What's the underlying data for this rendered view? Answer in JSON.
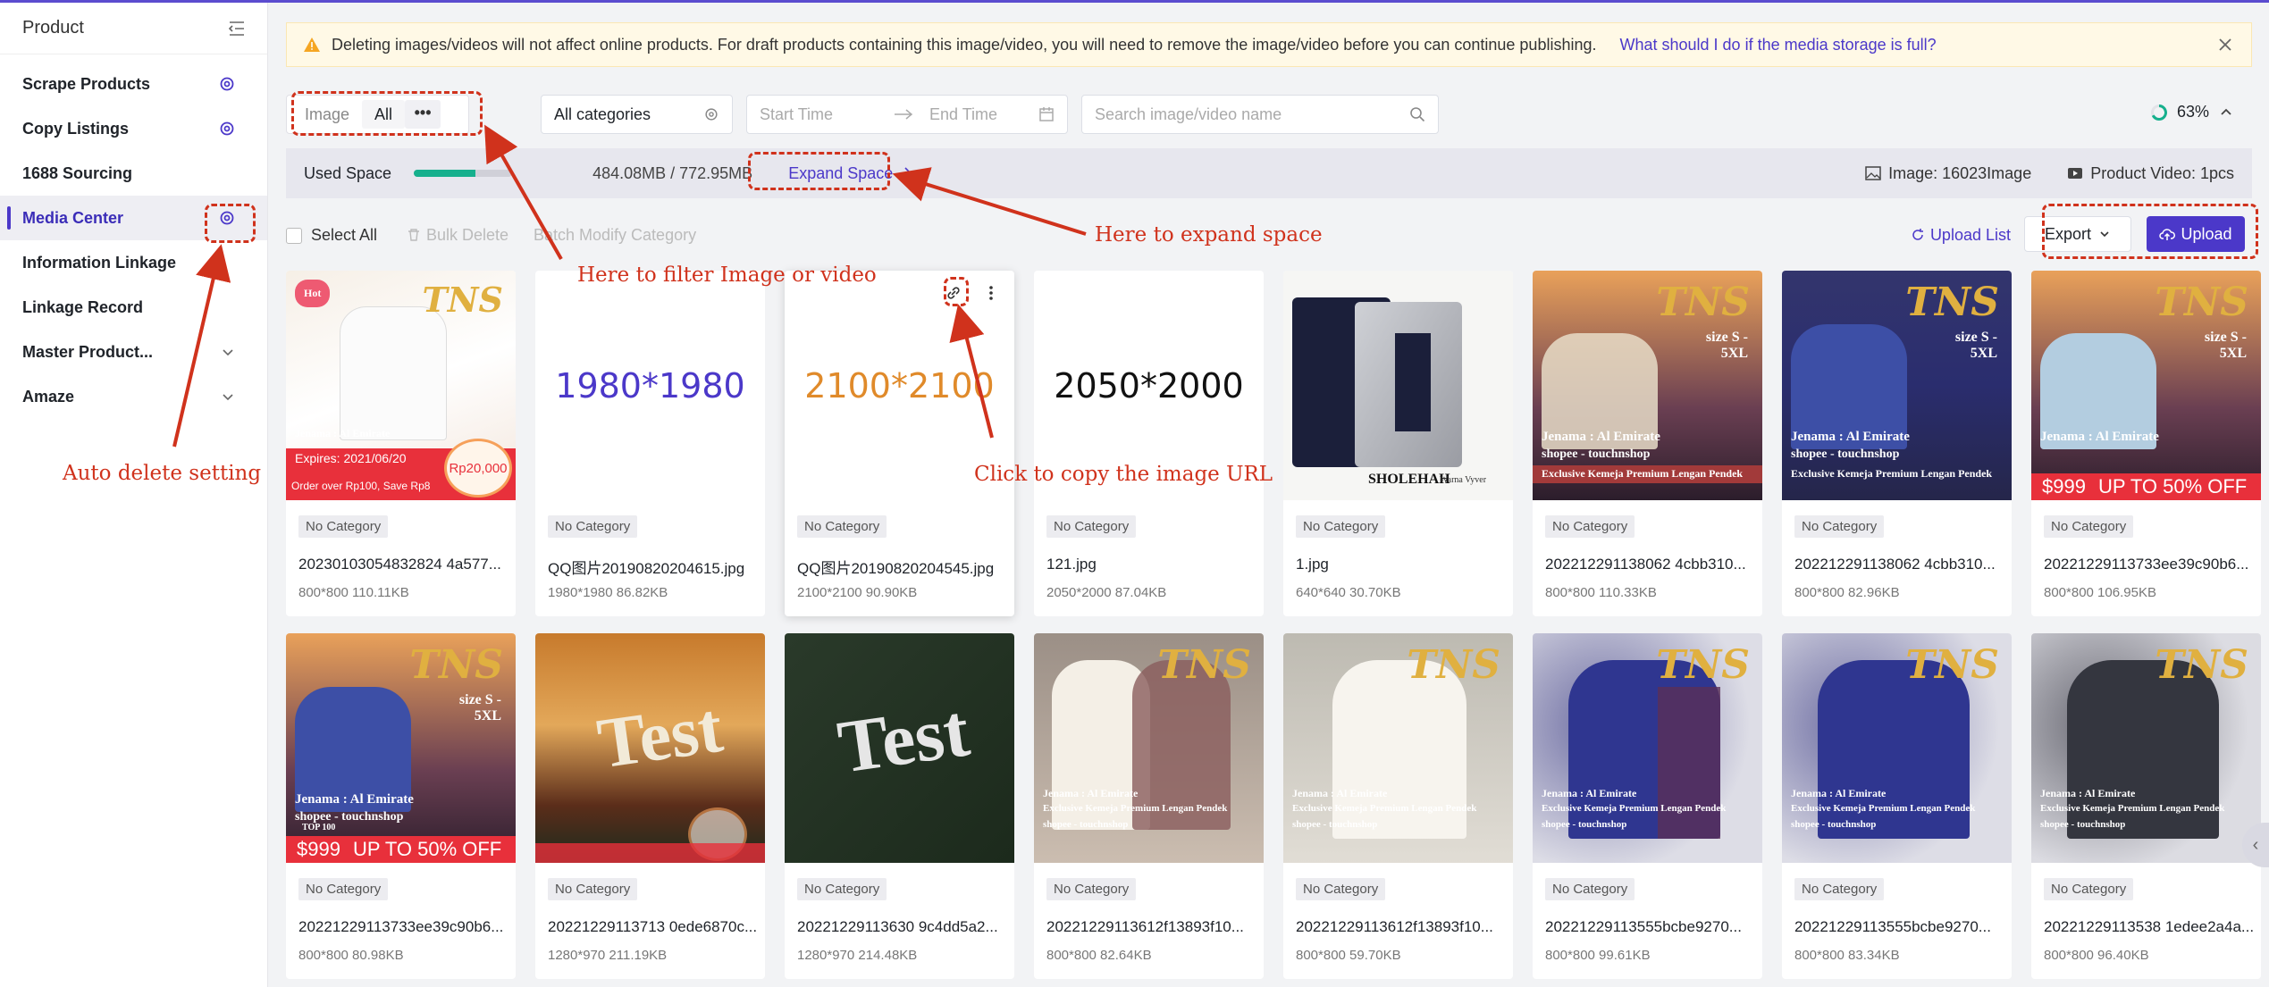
{
  "sidebar": {
    "title": "Product",
    "items": [
      {
        "label": "Scrape Products"
      },
      {
        "label": "Copy Listings"
      },
      {
        "label": "1688 Sourcing"
      },
      {
        "label": "Media Center"
      },
      {
        "label": "Information Linkage"
      },
      {
        "label": "Linkage Record"
      },
      {
        "label": "Master Product..."
      },
      {
        "label": "Amaze"
      }
    ]
  },
  "notice": {
    "text": "Deleting images/videos will not affect online products. For draft products containing this image/video, you will need to remove the image/video before you can continue publishing.",
    "help_link": "What should I do if the media storage is full?"
  },
  "filters": {
    "type_image": "Image",
    "type_all": "All",
    "more": "•••",
    "category": "All categories",
    "start_placeholder": "Start Time",
    "end_placeholder": "End Time",
    "search_placeholder": "Search image/video name",
    "progress": "63%"
  },
  "space": {
    "label": "Used Space",
    "usage": "484.08MB / 772.95MB",
    "used_fraction": 0.63,
    "expand": "Expand Space",
    "image_count": "Image: 16023Image",
    "video_count": "Product Video: 1pcs"
  },
  "actions": {
    "select_all": "Select All",
    "bulk_delete": "Bulk Delete",
    "batch_modify": "Batch Modify Category",
    "upload_list": "Upload List",
    "export": "Export",
    "upload": "Upload"
  },
  "cards": [
    {
      "category": "No Category",
      "name": "20230103054832824 4a577...",
      "meta": "800*800  110.11KB"
    },
    {
      "category": "No Category",
      "name": "QQ图片20190820204615.jpg",
      "meta": "1980*1980  86.82KB",
      "placeholder": "1980*1980"
    },
    {
      "category": "No Category",
      "name": "QQ图片20190820204545.jpg",
      "meta": "2100*2100  90.90KB",
      "placeholder": "2100*2100"
    },
    {
      "category": "No Category",
      "name": "121.jpg",
      "meta": "2050*2000  87.04KB",
      "placeholder": "2050*2000"
    },
    {
      "category": "No Category",
      "name": "1.jpg",
      "meta": "640*640  30.70KB"
    },
    {
      "category": "No Category",
      "name": "202212291138062 4cbb310...",
      "meta": "800*800  110.33KB"
    },
    {
      "category": "No Category",
      "name": "202212291138062 4cbb310...",
      "meta": "800*800  82.96KB"
    },
    {
      "category": "No Category",
      "name": "20221229113733ee39c90b6...",
      "meta": "800*800  106.95KB"
    },
    {
      "category": "No Category",
      "name": "20221229113733ee39c90b6...",
      "meta": "800*800  80.98KB"
    },
    {
      "category": "No Category",
      "name": "20221229113713 0ede6870c...",
      "meta": "1280*970  211.19KB"
    },
    {
      "category": "No Category",
      "name": "20221229113630 9c4dd5a2...",
      "meta": "1280*970  214.48KB"
    },
    {
      "category": "No Category",
      "name": "20221229113612f13893f10...",
      "meta": "800*800  82.64KB"
    },
    {
      "category": "No Category",
      "name": "20221229113612f13893f10...",
      "meta": "800*800  59.70KB"
    },
    {
      "category": "No Category",
      "name": "20221229113555bcbe9270...",
      "meta": "800*800  99.61KB"
    },
    {
      "category": "No Category",
      "name": "20221229113555bcbe9270...",
      "meta": "800*800  83.34KB"
    },
    {
      "category": "No Category",
      "name": "20221229113538 1edee2a4a...",
      "meta": "800*800  96.40KB"
    }
  ],
  "thumb_text": {
    "brand": "TNS",
    "size": "size S - 5XL",
    "jenama": "Jenama : Al Emirate",
    "shopee": "shopee - touchnshop",
    "exclusive": "Exclusive Kemeja Premium Lengan Pendek",
    "expires": "Expires:  2021/06/20",
    "hot": "Hot",
    "order_over": "Order over Rp100, Save Rp8",
    "price_rp": "Rp20,000",
    "price_999": "$999",
    "promo": "UP TO 50% OFF",
    "top100": "TOP 100",
    "test": "Test",
    "sholehah": "SHOLEHAH",
    "warna": "Warna Vyver"
  },
  "annotations": {
    "filter": "Here to filter Image or video",
    "expand": "Here to expand space",
    "copy_url": "Click to copy the image URL",
    "auto_delete": "Auto delete setting"
  },
  "colors": {
    "accent": "#4b38c9",
    "annotation": "#d0321c",
    "progress": "#16b08d"
  }
}
